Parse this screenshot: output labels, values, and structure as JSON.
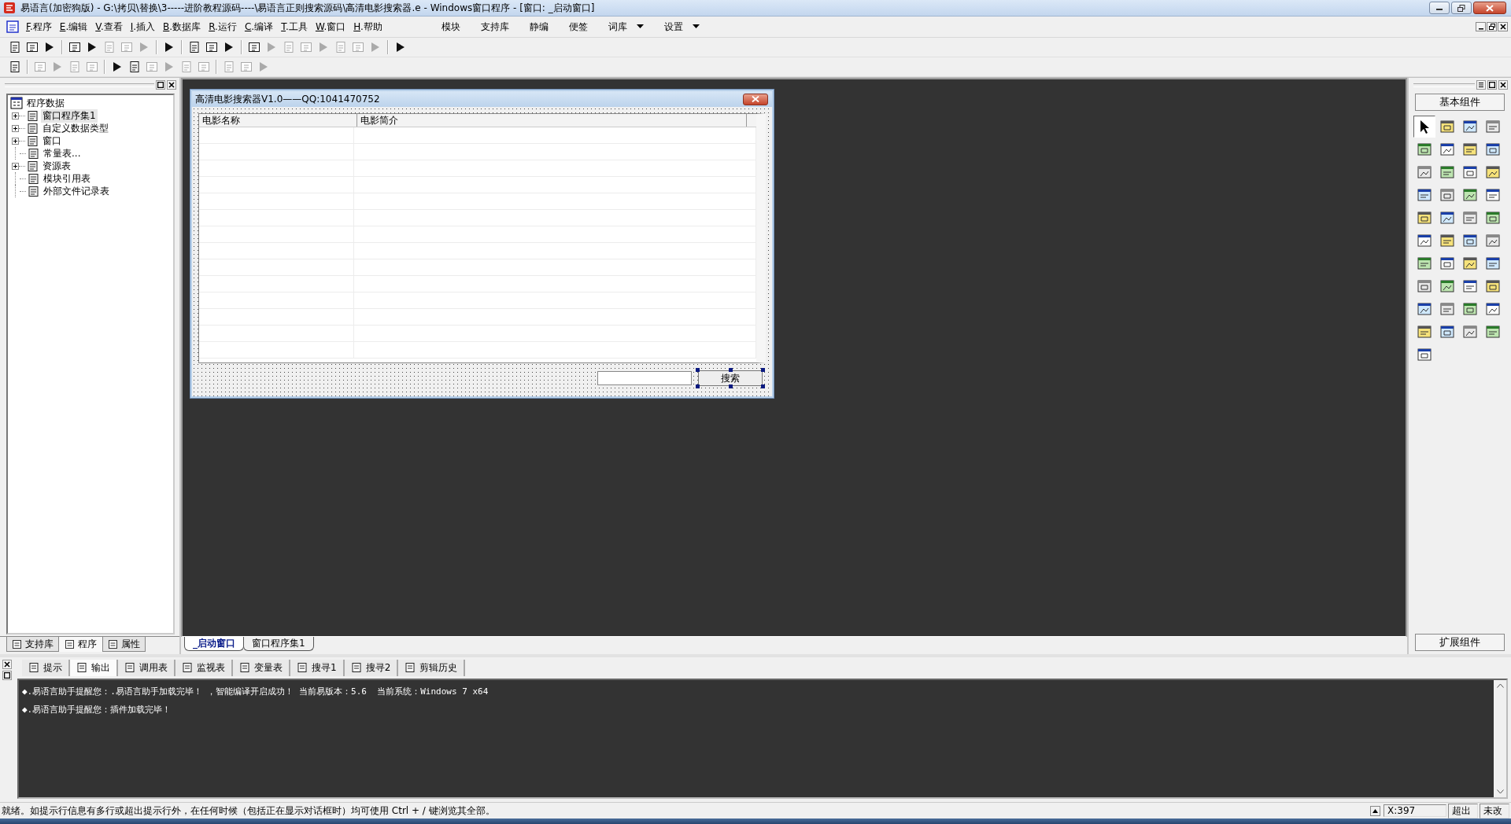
{
  "window": {
    "title": "易语言(加密狗版) - G:\\拷贝\\替换\\3-----进阶教程源码----\\易语言正则搜索源码\\高清电影搜索器.e - Windows窗口程序 - [窗口: _启动窗口]"
  },
  "menu": [
    {
      "key": "F",
      "label": ".程序"
    },
    {
      "key": "E",
      "label": ".编辑"
    },
    {
      "key": "V",
      "label": ".查看"
    },
    {
      "key": "I",
      "label": ".插入"
    },
    {
      "key": "B",
      "label": ".数据库"
    },
    {
      "key": "R",
      "label": ".运行"
    },
    {
      "key": "C",
      "label": ".编译"
    },
    {
      "key": "T",
      "label": ".工具"
    },
    {
      "key": "W",
      "label": ".窗口"
    },
    {
      "key": "H",
      "label": ".帮助"
    }
  ],
  "quick_menu": [
    {
      "label": "模块",
      "dropdown": false
    },
    {
      "label": "支持库",
      "dropdown": false
    },
    {
      "label": "静编",
      "dropdown": false
    },
    {
      "label": "便签",
      "dropdown": false
    },
    {
      "label": "词库",
      "dropdown": true
    },
    {
      "label": "设置",
      "dropdown": true
    }
  ],
  "toolbars": [
    {
      "groups": [
        [
          {
            "disabled": false
          },
          {
            "disabled": false
          },
          {
            "disabled": false
          }
        ],
        [
          {
            "disabled": false
          },
          {
            "disabled": false
          },
          {
            "disabled": true
          },
          {
            "disabled": true
          },
          {
            "disabled": true
          }
        ],
        [
          {
            "disabled": false
          }
        ],
        [
          {
            "disabled": false
          },
          {
            "disabled": false
          },
          {
            "disabled": false
          }
        ],
        [
          {
            "disabled": false
          },
          {
            "disabled": true
          },
          {
            "disabled": true
          },
          {
            "disabled": true
          },
          {
            "disabled": true
          },
          {
            "disabled": true
          },
          {
            "disabled": true
          },
          {
            "disabled": true
          }
        ],
        [
          {
            "disabled": false
          }
        ]
      ]
    },
    {
      "groups": [
        [
          {
            "disabled": false
          }
        ],
        [
          {
            "disabled": true
          },
          {
            "disabled": true
          },
          {
            "disabled": true
          },
          {
            "disabled": true
          }
        ],
        [
          {
            "disabled": false
          },
          {
            "disabled": false
          },
          {
            "disabled": true
          },
          {
            "disabled": true
          },
          {
            "disabled": true
          },
          {
            "disabled": true
          }
        ],
        [
          {
            "disabled": true
          },
          {
            "disabled": true
          },
          {
            "disabled": true
          }
        ]
      ]
    }
  ],
  "project_tree": {
    "root": "程序数据",
    "children": [
      {
        "label": "窗口程序集1",
        "kind": "folder",
        "selected": true
      },
      {
        "label": "自定义数据类型",
        "kind": "folder",
        "selected": false
      },
      {
        "label": "窗口",
        "kind": "folder",
        "selected": false
      },
      {
        "label": "常量表...",
        "kind": "leaf",
        "selected": false
      },
      {
        "label": "资源表",
        "kind": "folder",
        "selected": false
      },
      {
        "label": "模块引用表",
        "kind": "leaf",
        "selected": false
      },
      {
        "label": "外部文件记录表",
        "kind": "leaf",
        "selected": false
      }
    ]
  },
  "left_tabs": [
    {
      "label": "支持库",
      "selected": false
    },
    {
      "label": "程序",
      "selected": true
    },
    {
      "label": "属性",
      "selected": false
    }
  ],
  "form_designer": {
    "title": "高清电影搜索器V1.0——QQ:1041470752",
    "columns": [
      "电影名称",
      "电影简介"
    ],
    "button": "搜索"
  },
  "editor_tabs": [
    {
      "label": "_启动窗口",
      "selected": true
    },
    {
      "label": "窗口程序集1",
      "selected": false
    }
  ],
  "palette": {
    "title": "基本组件",
    "footer": "扩展组件",
    "tools": [
      {
        "selected": true
      },
      {
        "selected": false
      },
      {
        "selected": false
      },
      {
        "selected": false
      },
      {
        "selected": false
      },
      {
        "selected": false
      },
      {
        "selected": false
      },
      {
        "selected": false
      },
      {
        "selected": false
      },
      {
        "selected": false
      },
      {
        "selected": false
      },
      {
        "selected": false
      },
      {
        "selected": false
      },
      {
        "selected": false
      },
      {
        "selected": false
      },
      {
        "selected": false
      },
      {
        "selected": false
      },
      {
        "selected": false
      },
      {
        "selected": false
      },
      {
        "selected": false
      },
      {
        "selected": false
      },
      {
        "selected": false
      },
      {
        "selected": false
      },
      {
        "selected": false
      },
      {
        "selected": false
      },
      {
        "selected": false
      },
      {
        "selected": false
      },
      {
        "selected": false
      },
      {
        "selected": false
      },
      {
        "selected": false
      },
      {
        "selected": false
      },
      {
        "selected": false
      },
      {
        "selected": false
      },
      {
        "selected": false
      },
      {
        "selected": false
      },
      {
        "selected": false
      },
      {
        "selected": false
      },
      {
        "selected": false
      },
      {
        "selected": false
      },
      {
        "selected": false
      },
      {
        "selected": false
      }
    ]
  },
  "output_tabs": [
    {
      "label": "提示",
      "selected": false
    },
    {
      "label": "输出",
      "selected": true
    },
    {
      "label": "调用表",
      "selected": false
    },
    {
      "label": "监视表",
      "selected": false
    },
    {
      "label": "变量表",
      "selected": false
    },
    {
      "label": "搜寻1",
      "selected": false
    },
    {
      "label": "搜寻2",
      "selected": false
    },
    {
      "label": "剪辑历史",
      "selected": false
    }
  ],
  "output_lines": [
    "◆.易语言助手提醒您：.易语言助手加载完毕！ ，智能编译开启成功！ 当前易版本：5.6  当前系统：Windows 7 x64",
    "◆.易语言助手提醒您：插件加载完毕！"
  ],
  "status_bar": {
    "message": "就绪。如提示行信息有多行或超出提示行外，在任何时候（包括正在显示对话框时）均可使用 Ctrl + / 键浏览其全部。",
    "position": "X:397",
    "mode": "超出",
    "modified": "未改"
  }
}
